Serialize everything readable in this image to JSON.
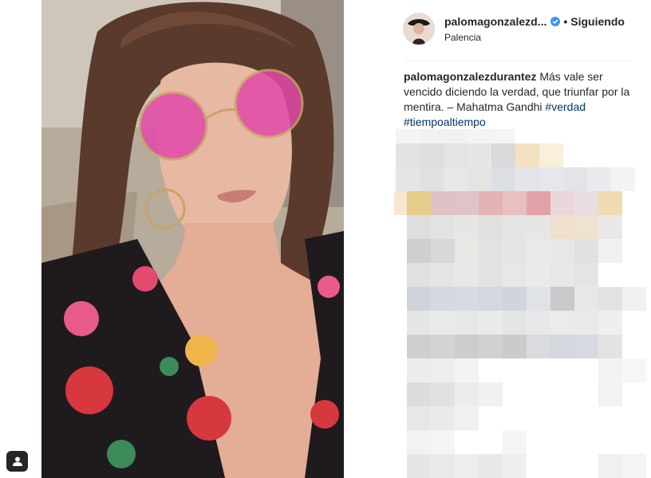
{
  "post": {
    "username": "palomagonzalezd...",
    "verified": true,
    "separator": "•",
    "follow_status": "Siguiendo",
    "location": "Palencia",
    "caption_user": "palomagonzalezdurantez",
    "caption_text": " Más vale ser vencido diciendo la verdad, que triunfar por la mentira. – Mahatma Gandhi ",
    "hashtags": [
      "#verdad",
      "#tiempoaltiempo"
    ]
  },
  "colors": {
    "hashtag": "#003569",
    "verified_badge": "#3897f0",
    "text": "#262626"
  },
  "icons": {
    "tag_button": "user-tag-icon",
    "verified": "verified-badge-icon"
  }
}
